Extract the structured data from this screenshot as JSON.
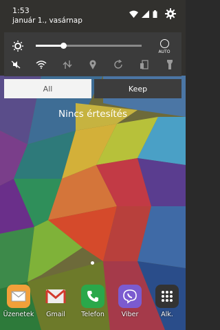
{
  "status_bar": {
    "time": "1:53",
    "date": "január 1., vasárnap"
  },
  "quick_settings": {
    "brightness_level": 0.26,
    "auto_label": "AUTO",
    "toggles": [
      "mute-vibrate",
      "wifi",
      "mobile-data",
      "location",
      "auto-rotate",
      "screen-mirror",
      "flashlight"
    ]
  },
  "tabs": {
    "all": "All",
    "keep": "Keep"
  },
  "notifications": {
    "empty_text": "Nincs értesítés"
  },
  "dock": {
    "apps": [
      {
        "label": "Üzenetek",
        "color": "#f2a03a"
      },
      {
        "label": "Gmail",
        "color": "#d23a2d"
      },
      {
        "label": "Telefon",
        "color": "#2aa84a"
      },
      {
        "label": "Viber",
        "color": "#7b5bd0"
      },
      {
        "label": "Alk.",
        "color": "#333333"
      }
    ]
  }
}
